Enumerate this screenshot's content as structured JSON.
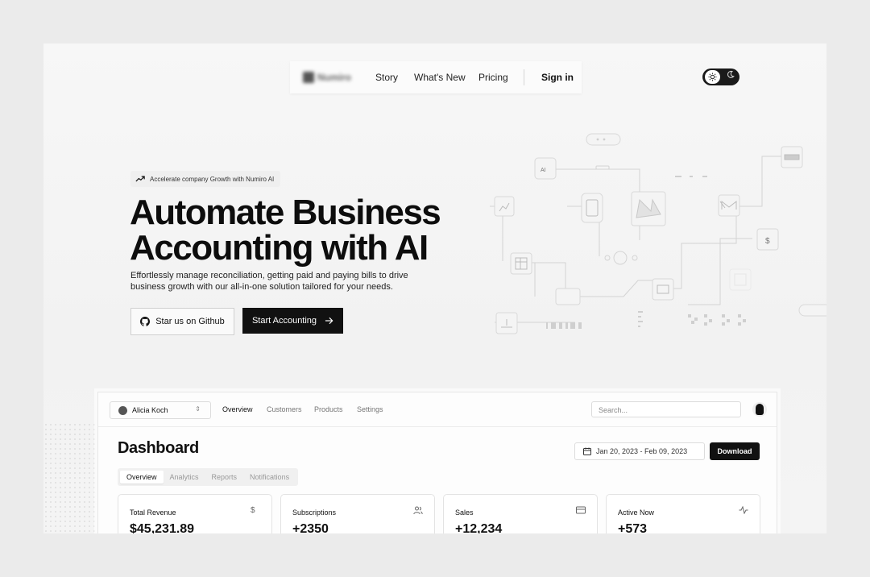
{
  "nav": {
    "logo_text": "Numiro",
    "links": [
      "Story",
      "What's New",
      "Pricing"
    ],
    "sign_in": "Sign in"
  },
  "theme_toggle": {
    "icon_light": "sun-icon",
    "icon_dark": "moon-icon",
    "selected": "light"
  },
  "hero": {
    "badge": "Accelerate company Growth with Numiro AI",
    "title_line1": "Automate Business",
    "title_line2": "Accounting with AI",
    "subtitle_line1": "Effortlessly manage reconciliation, getting paid and paying bills to drive",
    "subtitle_line2": "business growth with our all-in-one solution tailored for your needs.",
    "github_button": "Star us on Github",
    "start_button": "Start Accounting"
  },
  "illustration": {
    "node_labels": [
      "AI",
      "$"
    ]
  },
  "dashboard": {
    "account_name": "Alicia Koch",
    "nav": [
      "Overview",
      "Customers",
      "Products",
      "Settings"
    ],
    "search_placeholder": "Search...",
    "title": "Dashboard",
    "date_range": "Jan 20, 2023 - Feb 09, 2023",
    "download": "Download",
    "tabs": [
      "Overview",
      "Analytics",
      "Reports",
      "Notifications"
    ],
    "cards": [
      {
        "title": "Total Revenue",
        "value": "$45,231.89",
        "icon": "dollar-icon"
      },
      {
        "title": "Subscriptions",
        "value": "+2350",
        "icon": "users-icon"
      },
      {
        "title": "Sales",
        "value": "+12,234",
        "icon": "credit-card-icon"
      },
      {
        "title": "Active Now",
        "value": "+573",
        "icon": "activity-icon"
      }
    ]
  },
  "colors": {
    "accent": "#111111",
    "background": "#f4f4f4",
    "frame": "#ebebeb"
  }
}
